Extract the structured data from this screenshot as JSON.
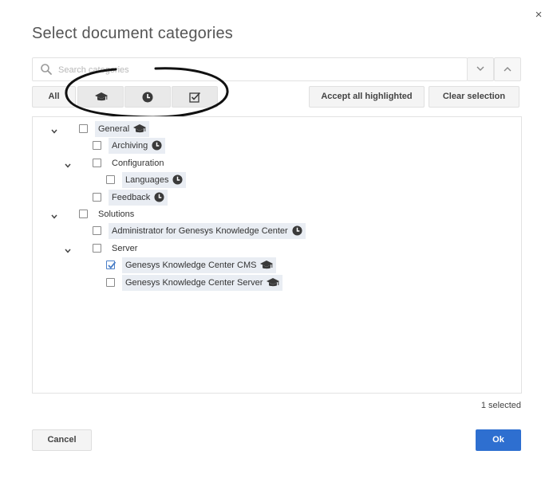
{
  "dialog": {
    "title": "Select document categories",
    "close_glyph": "×"
  },
  "search": {
    "placeholder": "Search categories",
    "value": ""
  },
  "filters": {
    "all_label": "All",
    "filter_icons": [
      "graduation-cap-icon",
      "clock-icon",
      "checkbox-icon"
    ]
  },
  "actions": {
    "accept_all_label": "Accept all highlighted",
    "clear_selection_label": "Clear selection"
  },
  "tree": [
    {
      "label": "General",
      "icon": "graduation-cap-icon",
      "level": 0,
      "expandable": true,
      "checked": false,
      "highlighted": true
    },
    {
      "label": "Archiving",
      "icon": "clock-icon",
      "level": 1,
      "expandable": false,
      "checked": false,
      "highlighted": true
    },
    {
      "label": "Configuration",
      "icon": "",
      "level": 1,
      "expandable": true,
      "checked": false,
      "highlighted": false
    },
    {
      "label": "Languages",
      "icon": "clock-icon",
      "level": 2,
      "expandable": false,
      "checked": false,
      "highlighted": true
    },
    {
      "label": "Feedback",
      "icon": "clock-icon",
      "level": 1,
      "expandable": false,
      "checked": false,
      "highlighted": true
    },
    {
      "label": "Solutions",
      "icon": "",
      "level": 0,
      "expandable": true,
      "checked": false,
      "highlighted": false
    },
    {
      "label": "Administrator for Genesys Knowledge Center",
      "icon": "clock-icon",
      "level": 1,
      "expandable": false,
      "checked": false,
      "highlighted": true
    },
    {
      "label": "Server",
      "icon": "",
      "level": 1,
      "expandable": true,
      "checked": false,
      "highlighted": false
    },
    {
      "label": "Genesys Knowledge Center CMS",
      "icon": "graduation-cap-icon",
      "level": 2,
      "expandable": false,
      "checked": true,
      "highlighted": true
    },
    {
      "label": "Genesys Knowledge Center Server",
      "icon": "graduation-cap-icon",
      "level": 2,
      "expandable": false,
      "checked": false,
      "highlighted": true
    }
  ],
  "footer": {
    "selected_text": "1 selected",
    "cancel_label": "Cancel",
    "ok_label": "Ok"
  },
  "colors": {
    "primary": "#2e6fd0",
    "highlight": "#e9edf3",
    "icon": "#3a3a3a"
  }
}
